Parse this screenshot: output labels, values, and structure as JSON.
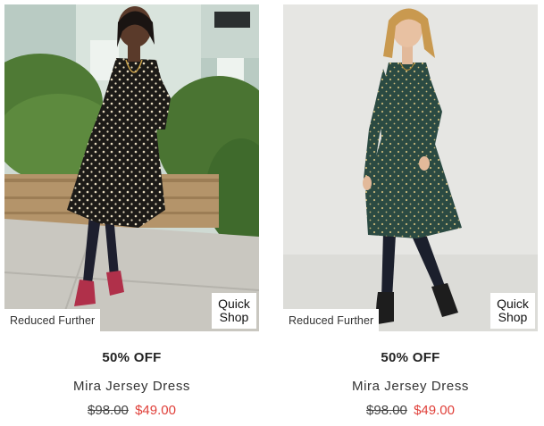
{
  "products": [
    {
      "badge": "Reduced Further",
      "quick_shop_line1": "Quick",
      "quick_shop_line2": "Shop",
      "discount": "50% OFF",
      "name": "Mira Jersey Dress",
      "was_price": "$98.00",
      "now_price": "$49.00",
      "dress_color": "#1c1a17",
      "dot_color": "#e8dcc0",
      "boot_color": "#b0304a",
      "background": "street"
    },
    {
      "badge": "Reduced Further",
      "quick_shop_line1": "Quick",
      "quick_shop_line2": "Shop",
      "discount": "50% OFF",
      "name": "Mira Jersey Dress",
      "was_price": "$98.00",
      "now_price": "$49.00",
      "dress_color": "#2b4a42",
      "dot_color": "#c9b77a",
      "boot_color": "#1d1d1d",
      "background": "studio"
    }
  ],
  "colors": {
    "sale_red": "#e0403a",
    "text_dark": "#222222"
  }
}
